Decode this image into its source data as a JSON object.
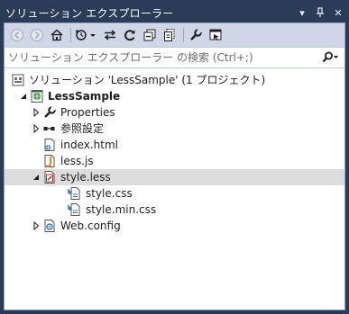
{
  "window": {
    "title": "ソリューション エクスプローラー",
    "pin_glyph": "▾",
    "autohide_glyph": "ᛘ",
    "close_glyph": "✕"
  },
  "toolbar": {
    "buttons": [
      "back-icon",
      "forward-icon",
      "home-icon",
      "history-icon",
      "sync-icon",
      "refresh-icon",
      "collapse-all-icon",
      "show-all-files-icon",
      "properties-icon",
      "preview-icon"
    ]
  },
  "search": {
    "placeholder": "ソリューション エクスプローラー の検索 (Ctrl+;)"
  },
  "tree": {
    "solution": "ソリューション 'LessSample' (1 プロジェクト)",
    "project": "LessSample",
    "items": {
      "properties": "Properties",
      "references": "参照設定",
      "index_html": "index.html",
      "less_js": "less.js",
      "style_less": "style.less",
      "style_css": "style.css",
      "style_min_css": "style.min.css",
      "web_config": "Web.config"
    }
  },
  "colors": {
    "frame": "#2b3c59",
    "toolbar": "#cfd6e5",
    "selection": "#dcdcdc"
  }
}
